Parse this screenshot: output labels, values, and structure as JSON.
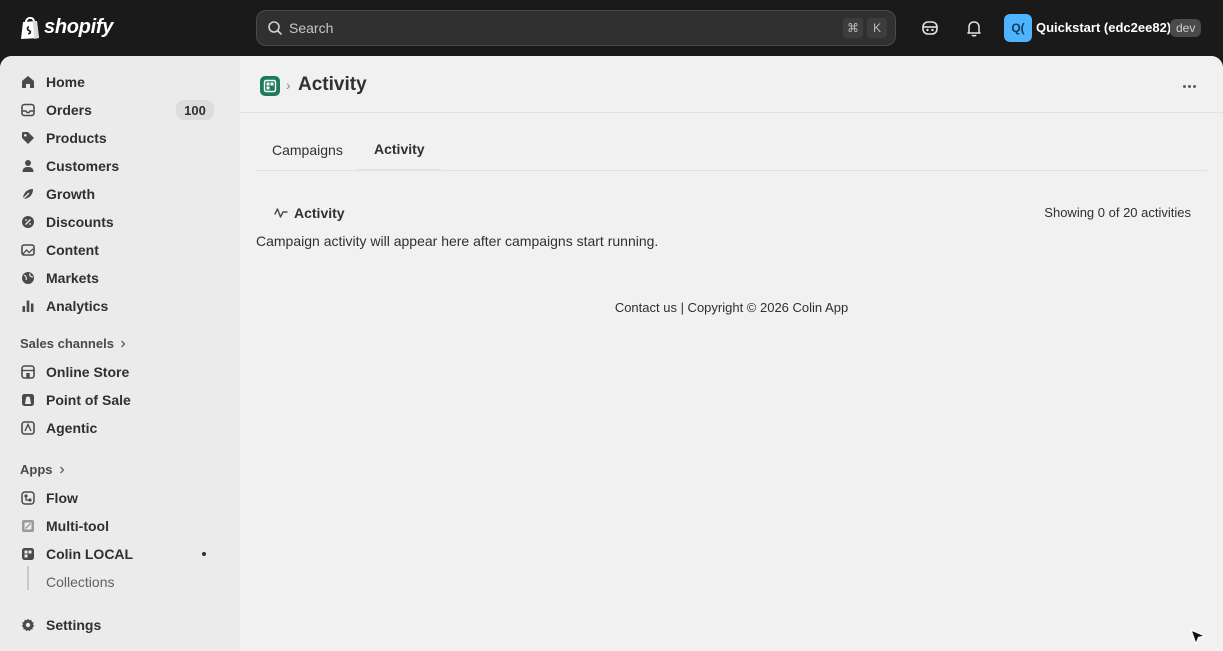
{
  "topbar": {
    "brand": "shopify",
    "search_placeholder": "Search",
    "shortcut_keys": [
      "⌘",
      "K"
    ],
    "store_initials": "Q(",
    "store_name": "Quickstart (edc2ee82)",
    "env_badge": "dev"
  },
  "sidebar": {
    "items": [
      {
        "label": "Home",
        "icon": "home-icon"
      },
      {
        "label": "Orders",
        "icon": "orders-icon",
        "badge": "100"
      },
      {
        "label": "Products",
        "icon": "tag-icon"
      },
      {
        "label": "Customers",
        "icon": "person-icon"
      },
      {
        "label": "Growth",
        "icon": "growth-icon"
      },
      {
        "label": "Discounts",
        "icon": "discount-icon"
      },
      {
        "label": "Content",
        "icon": "content-icon"
      },
      {
        "label": "Markets",
        "icon": "globe-icon"
      },
      {
        "label": "Analytics",
        "icon": "bar-chart-icon"
      }
    ],
    "sales_channels_heading": "Sales channels",
    "sales_channels": [
      {
        "label": "Online Store",
        "icon": "store-icon"
      },
      {
        "label": "Point of Sale",
        "icon": "pos-icon"
      },
      {
        "label": "Agentic",
        "icon": "agentic-icon"
      }
    ],
    "apps_heading": "Apps",
    "apps": [
      {
        "label": "Flow",
        "icon": "flow-icon"
      },
      {
        "label": "Multi-tool",
        "icon": "multitool-icon"
      },
      {
        "label": "Colin LOCAL",
        "icon": "app-grid-icon"
      }
    ],
    "sub_item": "Collections",
    "settings": "Settings"
  },
  "main": {
    "breadcrumb_sep": "›",
    "title": "Activity",
    "tabs": [
      {
        "label": "Campaigns",
        "active": false
      },
      {
        "label": "Activity",
        "active": true
      }
    ],
    "section_title": "Activity",
    "showing": "Showing 0 of 20 activities",
    "empty_message": "Campaign activity will appear here after campaigns start running.",
    "footer": "Contact us | Copyright © 2026 Colin App"
  },
  "colors": {
    "topbar_bg": "#1a1a1a",
    "sidebar_bg": "#ebebeb",
    "main_bg": "#f1f1f1",
    "store_avatar": "#4fb4ff",
    "app_icon": "#1e7a5d"
  }
}
